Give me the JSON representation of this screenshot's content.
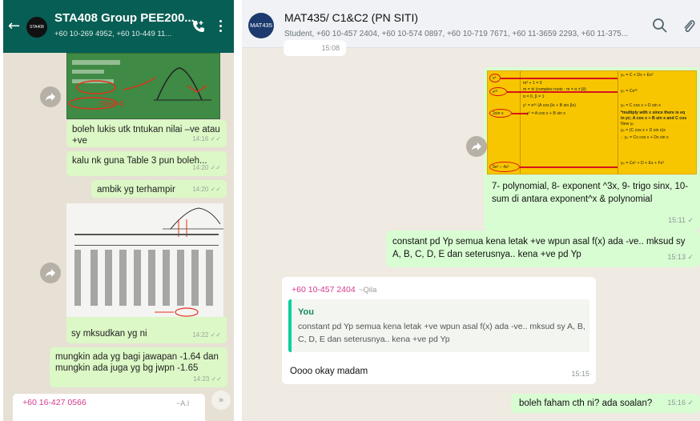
{
  "left": {
    "header": {
      "back_glyph": "←",
      "avatar_text": "STA408",
      "title": "STA408 Group PEE200...",
      "subtitle": "+60 10-269 4952, +60 10-449 11..."
    },
    "image1_note": "(Table 4)",
    "messages": [
      {
        "text": "boleh lukis utk tntukan nilai –ve atau +ve",
        "time": "14:16"
      },
      {
        "text": "kalu nk guna Table 3 pun boleh...",
        "time": "14:20"
      },
      {
        "text": "ambik yg terhampir",
        "time": "14:20"
      },
      {
        "text": "sy mksudkan yg ni",
        "time": "14:22"
      },
      {
        "text": "mungkin ada yg bagi jawapan -1.64 dan mungkin ada juga yg bg jwpn -1.65",
        "time": "14:23"
      }
    ],
    "incoming": {
      "sender": "+60 16-427 0566",
      "sender_name": "~A.I"
    },
    "scroll_glyph": "»"
  },
  "right": {
    "header": {
      "avatar_text": "MAT435",
      "title": "MAT435/ C1&C2 (PN SITI)",
      "subtitle": "Student, +60 10-457 2404, +60 10-574 0897, +60 10-719 7671, +60 11-3659 2293, +60 11-375..."
    },
    "top_partial_time": "15:08",
    "table": {
      "col1": [
        "x²",
        "e³ˣ",
        "2sin x",
        "5eˣ – 4x²"
      ],
      "col2_lines": [
        "m² + 1 = 0",
        "m = ±i (complex roots : m = α ± βi)",
        "α = 0, β = 1",
        "yᶜ = eᵅˣ (A cos βx + B sin βx)",
        "∴ yᶜ = A cos x + B sin x"
      ],
      "col3_lines": [
        "yₚ = C + Dx + Ex²",
        "yₚ = Ce³ˣ",
        "yₚ = C cos x + D sin x",
        "*multiply with x since there is eq",
        "in yc; A cos x + B sin x and C cos",
        "New yₚ",
        "yₚ = (C cos x + D sin x)x",
        "∴ yₚ = Cx cos x + Dx sin x",
        "yₚ = Ceˣ + D + Ex + Fx²"
      ]
    },
    "messages": {
      "m1_text": "7- polynomial, 8- exponent ^3x, 9- trigo sinx, 10- sum di antara exponent^x & polynomial",
      "m1_time": "15:11",
      "m2_text": "constant pd Yp semua kena letak +ve wpun asal f(x) ada -ve.. mksud sy A, B, C, D, E dan seterusnya.. kena +ve pd Yp",
      "m2_time": "15:13",
      "reply_sender": "+60 10-457 2404",
      "reply_name": "~Qila",
      "quote_author": "You",
      "quote_text": "constant pd Yp semua kena letak +ve wpun asal f(x) ada -ve.. mksud sy A, B, C, D, E dan seterusnya.. kena +ve pd Yp",
      "reply_text": "Oooo okay madam",
      "reply_time": "15:15",
      "m4_text": "boleh faham cth ni? ada soalan?",
      "m4_time": "15:16"
    }
  },
  "colors": {
    "whatsapp_green_dark": "#075e54",
    "bubble_out_phone": "#dcf8c6",
    "bubble_out_desktop": "#d9fdd3",
    "sender_pink": "#d6398e",
    "quote_bar": "#06cf9c",
    "table_yellow": "#f7c600",
    "highlight_red": "#d8141a"
  }
}
